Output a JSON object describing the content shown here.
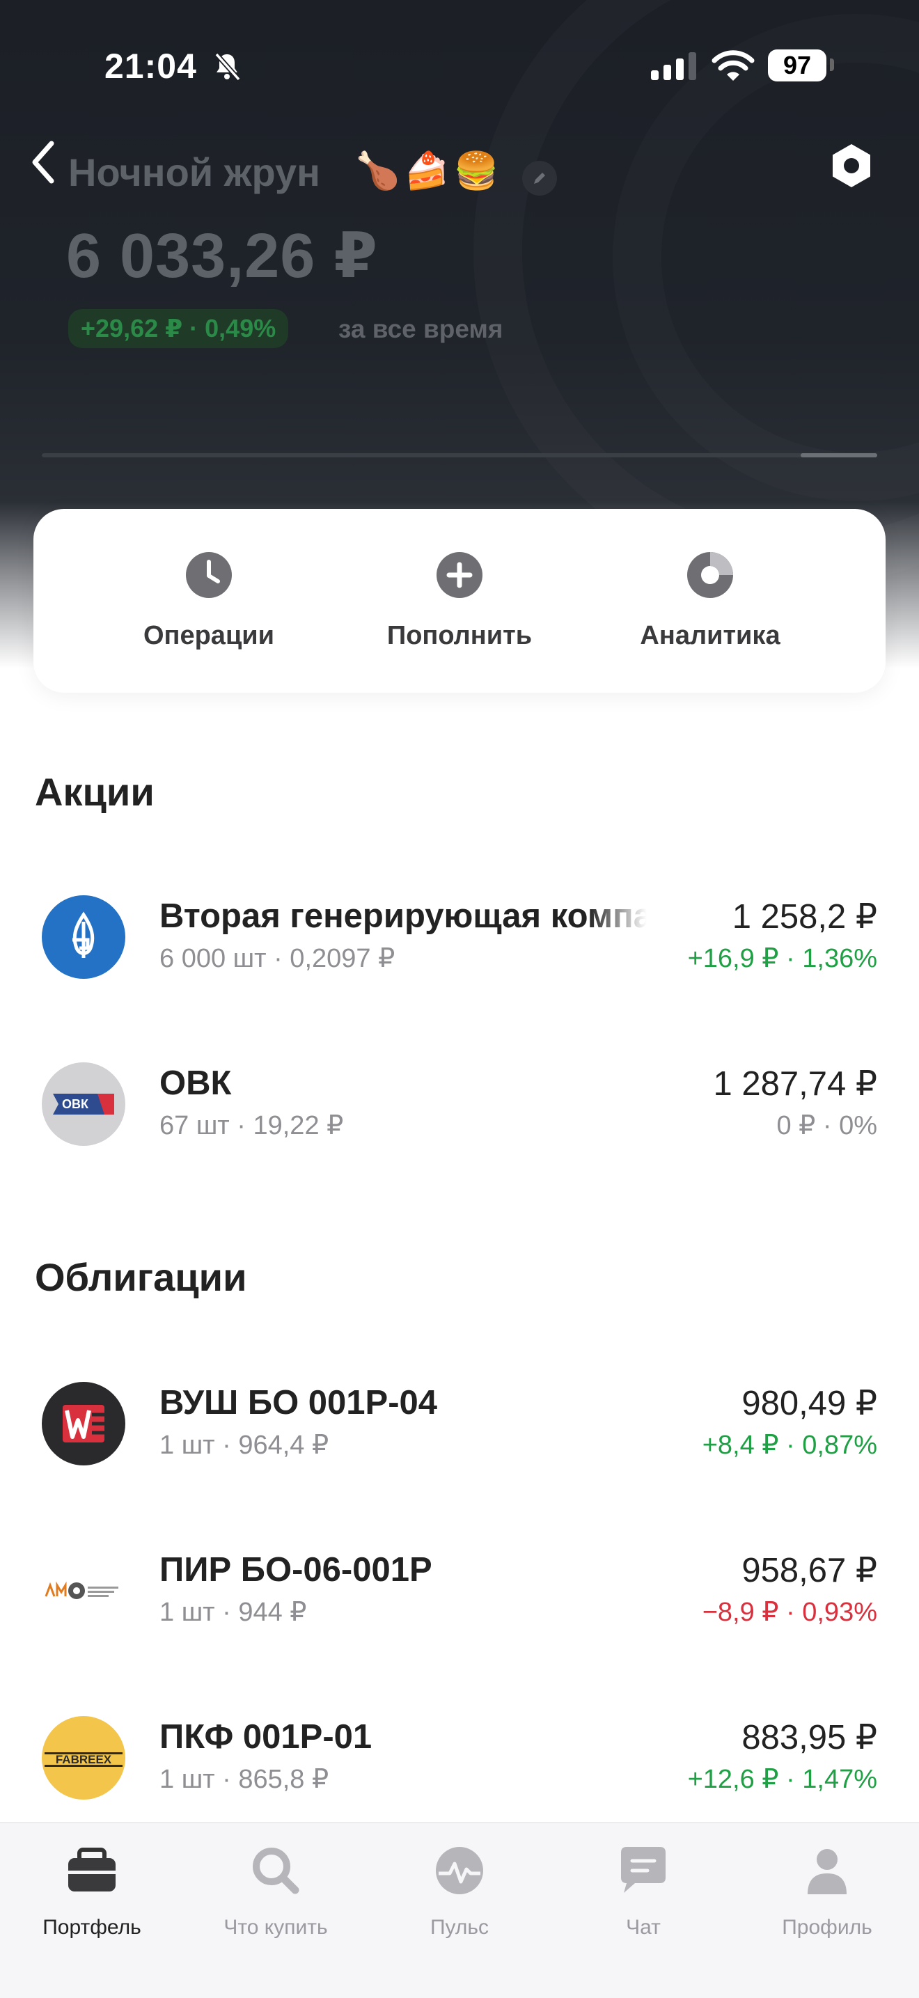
{
  "status_bar": {
    "time": "21:04",
    "battery": "97"
  },
  "header": {
    "portfolio_name": "Ночной жрун",
    "portfolio_emoji": [
      "🍗",
      "🍰",
      "🍔"
    ],
    "total_value": "6 033,26 ₽",
    "change": "+29,62 ₽ · 0,49%",
    "change_period": "за все время"
  },
  "actions": [
    {
      "label": "Операции",
      "icon": "clock-icon"
    },
    {
      "label": "Пополнить",
      "icon": "plus-icon"
    },
    {
      "label": "Аналитика",
      "icon": "pie-chart-icon"
    }
  ],
  "sections": {
    "stocks": {
      "title": "Акции",
      "items": [
        {
          "name": "Вторая генерирующая компания",
          "sub": "6 000 шт · 0,2097 ₽",
          "price": "1 258,2 ₽",
          "change": "+16,9 ₽ · 1,36%",
          "trend": "pos",
          "logo": "gazprom-logo"
        },
        {
          "name": "ОВК",
          "sub": "67 шт · 19,22 ₽",
          "price": "1 287,74 ₽",
          "change": "0 ₽ · 0%",
          "trend": "zero",
          "logo": "ovk-logo",
          "logo_text": "ОВК"
        }
      ]
    },
    "bonds": {
      "title": "Облигации",
      "items": [
        {
          "name": "ВУШ БО 001P-04",
          "sub": "1 шт · 964,4 ₽",
          "price": "980,49 ₽",
          "change": "+8,4 ₽ · 0,87%",
          "trend": "pos",
          "logo": "whoosh-logo"
        },
        {
          "name": "ПИР БО-06-001Р",
          "sub": "1 шт · 944 ₽",
          "price": "958,67 ₽",
          "change": "−8,9 ₽ · 0,93%",
          "trend": "neg",
          "logo": "pir-logo"
        },
        {
          "name": "ПКФ 001Р-01",
          "sub": "1 шт · 865,8 ₽",
          "price": "883,95 ₽",
          "change": "+12,6 ₽ · 1,47%",
          "trend": "pos",
          "logo": "fabreex-logo",
          "logo_text": "FABREEX"
        }
      ]
    }
  },
  "tab_bar": [
    {
      "label": "Портфель",
      "icon": "briefcase-icon",
      "active": true
    },
    {
      "label": "Что купить",
      "icon": "search-icon",
      "active": false
    },
    {
      "label": "Пульс",
      "icon": "pulse-icon",
      "active": false
    },
    {
      "label": "Чат",
      "icon": "chat-icon",
      "active": false
    },
    {
      "label": "Профиль",
      "icon": "profile-icon",
      "active": false
    }
  ],
  "colors": {
    "positive": "#1fa045",
    "negative": "#d9303e",
    "neutral": "#8e8e93",
    "header_bg": "#1c1f26"
  }
}
